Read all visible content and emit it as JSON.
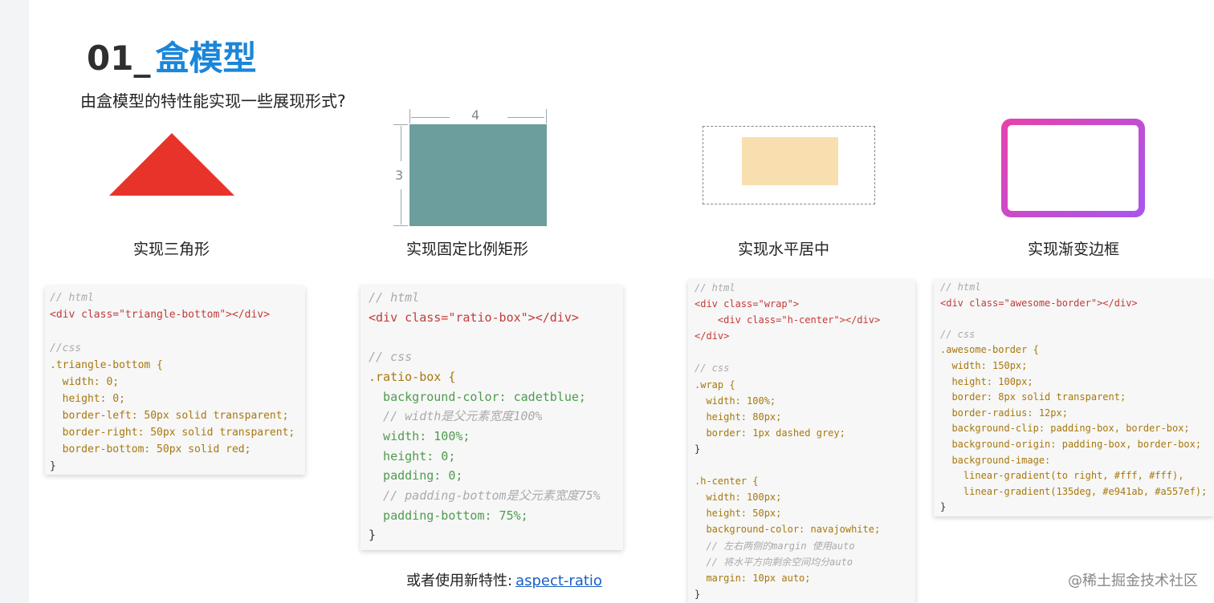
{
  "header": {
    "number": "01_",
    "title": "盒模型"
  },
  "subtitle": "由盒模型的特性能实现一些展现形式?",
  "examples": {
    "triangle": {
      "caption": "实现三角形"
    },
    "ratio": {
      "caption": "实现固定比例矩形",
      "width_label": "4",
      "height_label": "3"
    },
    "center": {
      "caption": "实现水平居中"
    },
    "gradient": {
      "caption": "实现渐变边框"
    }
  },
  "code1": [
    "// html",
    "<div class=\"triangle-bottom\"></div>",
    "",
    "//css",
    ".triangle-bottom {",
    "  width: 0;",
    "  height: 0;",
    "  border-left: 50px solid transparent;",
    "  border-right: 50px solid transparent;",
    "  border-bottom: 50px solid red;",
    "}"
  ],
  "code2": [
    "// html",
    "<div class=\"ratio-box\"></div>",
    "",
    "// css",
    ".ratio-box {",
    "  background-color: cadetblue;",
    "  // width是父元素宽度100%",
    "  width: 100%;",
    "  height: 0;",
    "  padding: 0;",
    "  // padding-bottom是父元素宽度75%",
    "  padding-bottom: 75%;",
    "}"
  ],
  "code3": [
    "// html",
    "<div class=\"wrap\">",
    "    <div class=\"h-center\"></div>",
    "</div>",
    "",
    "// css",
    ".wrap {",
    "  width: 100%;",
    "  height: 80px;",
    "  border: 1px dashed grey;",
    "}",
    "",
    ".h-center {",
    "  width: 100px;",
    "  height: 50px;",
    "  background-color: navajowhite;",
    "  // 左右两侧的margin 使用auto",
    "  // 将水平方向剩余空间均分auto",
    "  margin: 10px auto;",
    "}"
  ],
  "code4": [
    "// html",
    "<div class=\"awesome-border\"></div>",
    "",
    "// css",
    ".awesome-border {",
    "  width: 150px;",
    "  height: 100px;",
    "  border: 8px solid transparent;",
    "  border-radius: 12px;",
    "  background-clip: padding-box, border-box;",
    "  background-origin: padding-box, border-box;",
    "  background-image:",
    "    linear-gradient(to right, #fff, #fff),",
    "    linear-gradient(135deg, #e941ab, #a557ef);",
    "}"
  ],
  "aspect": {
    "prefix": "或者使用新特性:",
    "link": "aspect-ratio"
  },
  "footer": "@稀土掘金技术社区",
  "colors": {
    "title_accent": "#1a86d9",
    "triangle": "#e8332a",
    "ratio_rect": "#6b9e9c",
    "h_center": "#f9dfb0",
    "gradient_start": "#e941ab",
    "gradient_end": "#a557ef"
  }
}
